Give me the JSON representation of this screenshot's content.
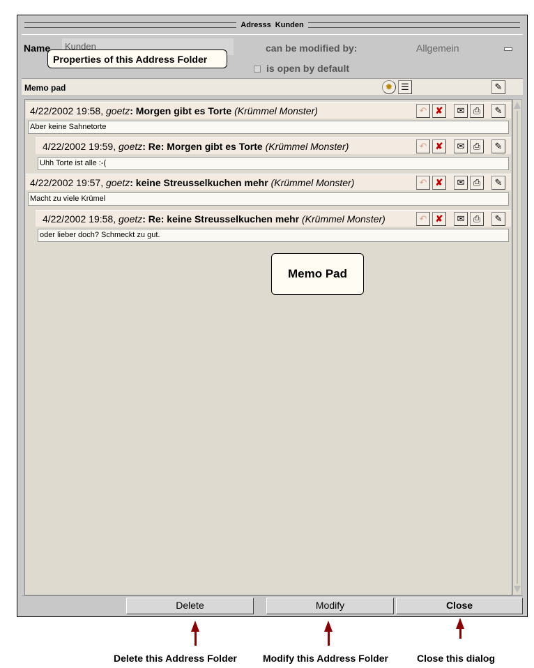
{
  "window": {
    "title": "Adresss  Kunden"
  },
  "properties": {
    "name_label": "Name",
    "name_value": "Kunden",
    "modified_by_label": "can be modified by:",
    "modified_by_value": "Allgemein",
    "open_default_label": "is open by default"
  },
  "callouts": {
    "properties": "Properties of this Address Folder",
    "memo_pad": "Memo Pad"
  },
  "memo_pad": {
    "title": "Memo pad",
    "entries": [
      {
        "date": "4/22/2002 19:58,",
        "user": "goetz",
        "subject": ": Morgen gibt es Torte",
        "author": "(Krümmel Monster)",
        "body": "Aber keine Sahnetorte",
        "indent": 0
      },
      {
        "date": "4/22/2002 19:59,",
        "user": "goetz",
        "subject": ": Re:  Morgen gibt es Torte",
        "author": "(Krümmel Monster)",
        "body": "Uhh Torte ist alle :-(",
        "indent": 1
      },
      {
        "date": "4/22/2002 19:57,",
        "user": "goetz",
        "subject": ": keine Streusselkuchen mehr",
        "author": "(Krümmel Monster)",
        "body": "Macht zu viele Krümel",
        "indent": 0
      },
      {
        "date": "4/22/2002 19:58,",
        "user": "goetz",
        "subject": ": Re:  keine Streusselkuchen mehr",
        "author": "(Krümmel Monster)",
        "body": "oder lieber doch? Schmeckt zu gut.",
        "indent": 1
      }
    ]
  },
  "buttons": {
    "delete": "Delete",
    "modify": "Modify",
    "close": "Close"
  },
  "annotations": {
    "delete": "Delete this Address Folder",
    "modify": "Modify this Address Folder",
    "close": "Close this dialog"
  },
  "colors": {
    "arrow": "#8b0000",
    "callout_bg": "#fffdf3",
    "memo_row": "#f3ebe2"
  }
}
